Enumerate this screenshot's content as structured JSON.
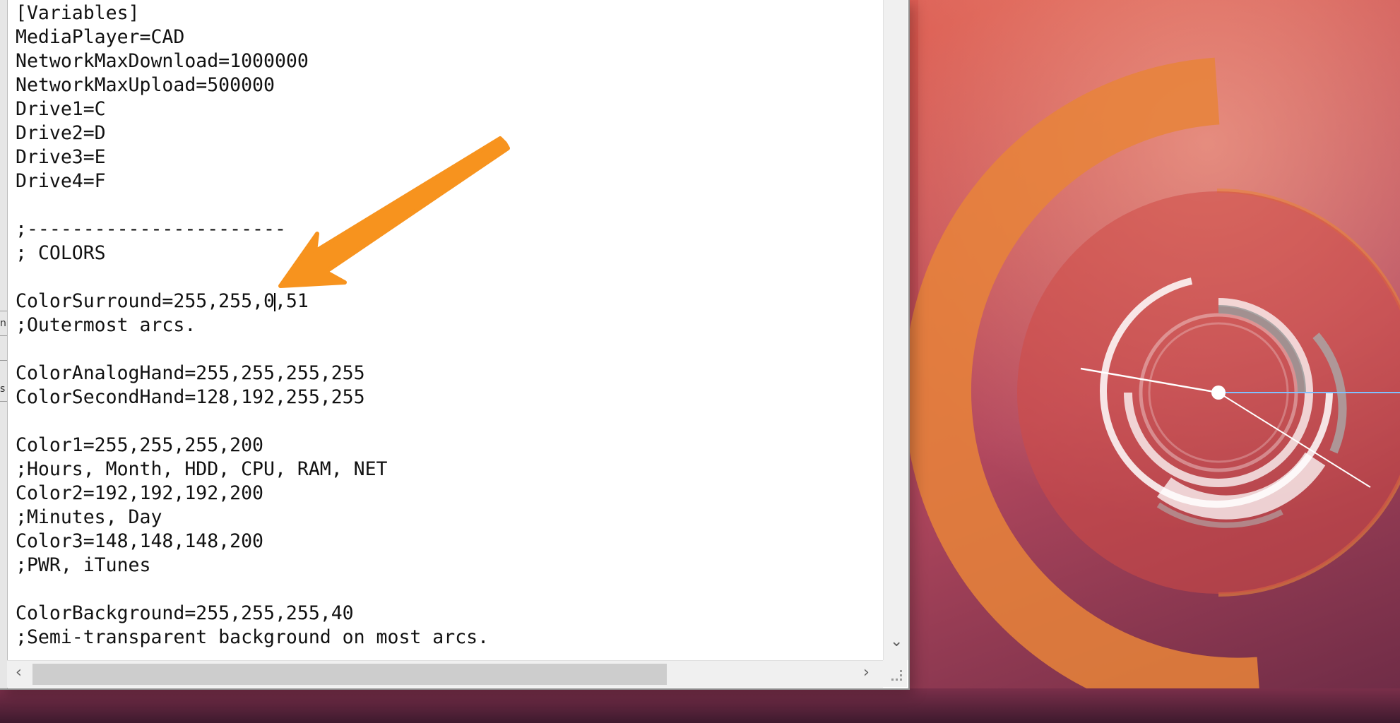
{
  "editor": {
    "lines": [
      "[Variables]",
      "MediaPlayer=CAD",
      "NetworkMaxDownload=1000000",
      "NetworkMaxUpload=500000",
      "Drive1=C",
      "Drive2=D",
      "Drive3=E",
      "Drive4=F",
      "",
      ";-----------------------",
      "; COLORS",
      "",
      "ColorSurround=255,255,0,51",
      ";Outermost arcs.",
      "",
      "ColorAnalogHand=255,255,255,255",
      "ColorSecondHand=128,192,255,255",
      "",
      "Color1=255,255,255,200",
      ";Hours, Month, HDD, CPU, RAM, NET",
      "Color2=192,192,192,200",
      ";Minutes, Day",
      "Color3=148,148,148,200",
      ";PWR, iTunes",
      "",
      "ColorBackground=255,255,255,40",
      ";Semi-transparent background on most arcs."
    ],
    "caret_line_before": "ColorSurround=255,255,0",
    "caret_line_after": ",51"
  },
  "scrollbar": {
    "left_arrow": "‹",
    "right_arrow": "›",
    "down_arrow": "⌄"
  },
  "left_frame_glyphs": [
    "n",
    "s"
  ],
  "colors": {
    "annotation_arrow": "#f7931e",
    "desktop_accent": "#e07a35",
    "clock_white": "#ffffff"
  }
}
